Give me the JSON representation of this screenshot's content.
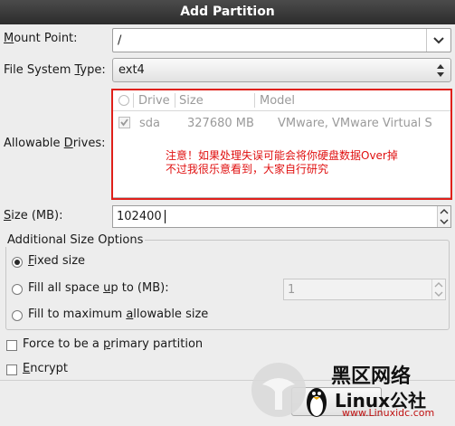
{
  "window": {
    "title": "Add Partition"
  },
  "mount_point": {
    "label_mnemonic": "M",
    "label_rest": "ount Point:",
    "value": "/"
  },
  "file_system_type": {
    "label_pre": "File System ",
    "label_mnemonic": "T",
    "label_post": "ype:",
    "value": "ext4"
  },
  "allowable_drives": {
    "label_pre": "Allowable ",
    "label_mnemonic": "D",
    "label_post": "rives:",
    "columns": [
      "Drive",
      "Size",
      "Model"
    ],
    "rows": [
      {
        "checked": true,
        "drive": "sda",
        "size": "327680 MB",
        "model": "VMware, VMware Virtual S"
      }
    ],
    "annotation_line1": "注意！如果处理失误可能会将你硬盘数据Over掉",
    "annotation_line2": "不过我很乐意看到，大家自行研究"
  },
  "size": {
    "label_mnemonic": "S",
    "label_rest": "ize (MB):",
    "value": "102400"
  },
  "additional_size": {
    "title": "Additional Size Options",
    "options": [
      {
        "pre": "",
        "mnemonic": "F",
        "post": "ixed size",
        "selected": true
      },
      {
        "pre": "Fill all space ",
        "mnemonic": "u",
        "post": "p to (MB):",
        "selected": false
      },
      {
        "pre": "Fill to maximum ",
        "mnemonic": "a",
        "post": "llowable size",
        "selected": false
      }
    ],
    "fill_up_to_value": "1"
  },
  "force_primary": {
    "pre": "Force to be a ",
    "mnemonic": "p",
    "post": "rimary partition",
    "checked": false
  },
  "encrypt": {
    "mnemonic": "E",
    "post": "ncrypt",
    "checked": false
  },
  "watermark": {
    "line1": "Linux公社",
    "line2": "www.Linuxidc.com"
  },
  "colors": {
    "titlebar": "#3a3a3a",
    "annotation_red": "#e01010",
    "highlight_box": "#e0201a"
  }
}
